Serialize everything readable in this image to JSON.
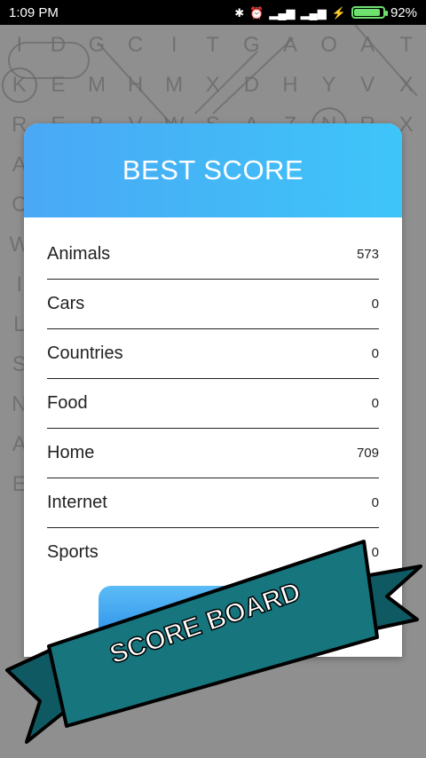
{
  "status_bar": {
    "time": "1:09 PM",
    "battery_percent": "92%",
    "battery_level": 0.92,
    "icons": [
      "bluetooth-icon",
      "alarm-icon",
      "signal-icon",
      "signal-icon",
      "charging-icon",
      "battery-icon"
    ]
  },
  "background_grid": [
    "I",
    "D",
    "G",
    "C",
    "I",
    "T",
    "G",
    "A",
    "O",
    "A",
    "T",
    "K",
    "E",
    "M",
    "H",
    "M",
    "X",
    "D",
    "H",
    "Y",
    "V",
    "X",
    "R",
    "E",
    "B",
    "V",
    "W",
    "S",
    "A",
    "Z",
    "N",
    "R",
    "X",
    "A",
    "",
    "",
    "",
    "",
    "",
    "",
    "",
    "",
    "",
    "",
    "C",
    "",
    "",
    "",
    "",
    "",
    "",
    "",
    "",
    "",
    "",
    "W",
    "",
    "",
    "",
    "",
    "",
    "",
    "",
    "",
    "",
    "",
    "I",
    "",
    "",
    "",
    "",
    "",
    "",
    "",
    "",
    "",
    "",
    "L",
    "",
    "",
    "",
    "",
    "",
    "",
    "",
    "",
    "",
    "",
    "S",
    "",
    "",
    "",
    "",
    "",
    "",
    "",
    "",
    "",
    "",
    "N",
    "",
    "",
    "",
    "",
    "",
    "",
    "",
    "",
    "",
    "",
    "A",
    "",
    "",
    "",
    "",
    "",
    "",
    "",
    "",
    "",
    "",
    "E",
    "",
    "",
    "",
    "",
    "",
    "",
    "",
    "",
    "",
    ""
  ],
  "dialog": {
    "title": "BEST SCORE",
    "rows": [
      {
        "name": "Animals",
        "score": "573"
      },
      {
        "name": "Cars",
        "score": "0"
      },
      {
        "name": "Countries",
        "score": "0"
      },
      {
        "name": "Food",
        "score": "0"
      },
      {
        "name": "Home",
        "score": "709"
      },
      {
        "name": "Internet",
        "score": "0"
      },
      {
        "name": "Sports",
        "score": "0"
      }
    ]
  },
  "ribbon": {
    "text": "SCORE BOARD",
    "color": "#17757e"
  },
  "colors": {
    "header_start": "#4aa8f5",
    "header_end": "#3ec5f8",
    "button": "#2b8fe8"
  }
}
